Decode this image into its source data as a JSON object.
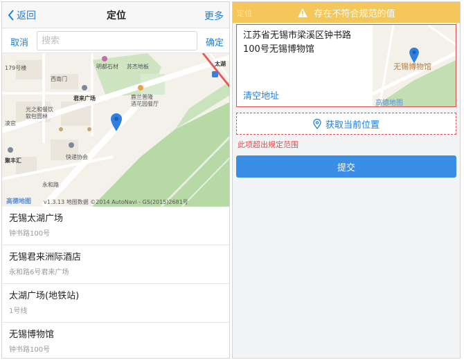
{
  "left": {
    "nav": {
      "back_label": "返回",
      "title": "定位",
      "more_label": "更多"
    },
    "search": {
      "cancel_label": "取消",
      "placeholder": "搜索",
      "value": "",
      "confirm_label": "确定"
    },
    "map": {
      "labels": {
        "road_179": "179号楼",
        "mingdu": "明都石材",
        "suzhou": "苏杰地板",
        "taihu": "太湖",
        "ximen": "西南门",
        "junlai": "君来广场",
        "lanting": "鹿兰普隆",
        "jiayuan": "酒花园餐厅",
        "guangzhi": "光之和餐饮",
        "ruanyuan": "软包圆林",
        "kuaidi": "快递协会",
        "dongfeng": "聚丰汇",
        "yonghe": "永和路",
        "lingu": "凌官"
      },
      "logo": "高德地图",
      "copyright": "v1.3.13 地图数据 ©2014 AutoNavi - GS(2015)2681号"
    },
    "results": [
      {
        "name": "无锡太湖广场",
        "address": "钟书路100号"
      },
      {
        "name": "无锡君来洲际酒店",
        "address": "永和路6号君来广场"
      },
      {
        "name": "太湖广场(地铁站)",
        "address": "1号线"
      },
      {
        "name": "无锡博物馆",
        "address": "钟书路100号"
      }
    ]
  },
  "right": {
    "warning": {
      "faint_label": "定位",
      "text": "存在不符合规范的值"
    },
    "address": {
      "text": "江苏省无锡市梁溪区钟书路100号无锡博物馆",
      "clear_label": "清空地址",
      "map_label": "无锡博物馆",
      "map_logo": "高德地图"
    },
    "get_location_label": "获取当前位置",
    "error_text": "此项超出规定范围",
    "submit_label": "提交"
  },
  "colors": {
    "accent": "#1b7fe0",
    "warning_bg": "#f5c659",
    "error": "#e24b4b",
    "submit_bg": "#3b8ee6",
    "pin": "#2f7fe0"
  }
}
